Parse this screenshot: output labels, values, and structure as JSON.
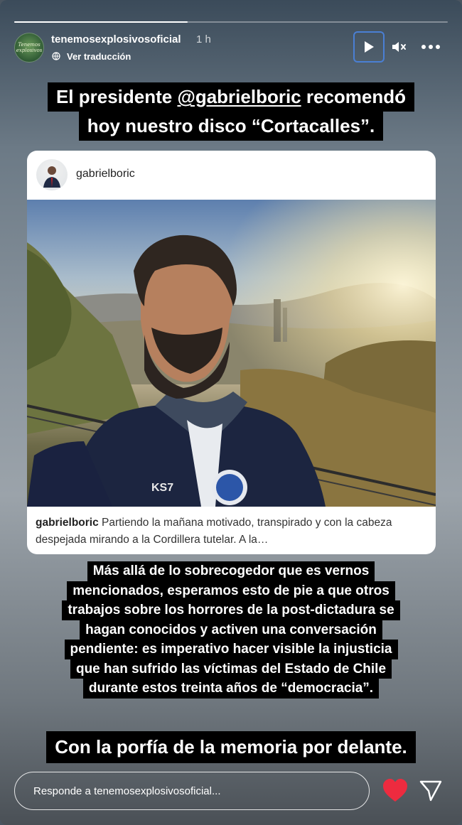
{
  "story": {
    "progress": 0.4,
    "username": "tenemosexplosivosoficial",
    "time": "1 h",
    "translate_label": "Ver traducción",
    "avatar_text": "Tenemos explosivos"
  },
  "headline": {
    "line1_prefix": "El presidente ",
    "line1_mention": "@gabrielboric",
    "line1_suffix": " recomendó",
    "line2": "hoy nuestro disco “Cortacalles”."
  },
  "card": {
    "username": "gabrielboric",
    "caption_user": "gabrielboric",
    "caption_text": "Partiendo la mañana motivado, transpirado y con la cabeza despejada mirando a la Cordillera tutelar. A la…",
    "jacket_text": "KS7"
  },
  "paragraph": [
    "Más allá de lo sobrecogedor que es vernos",
    "mencionados, esperamos esto de pie a que otros",
    "trabajos sobre los horrores de la post-dictadura se",
    "hagan conocidos y activen una conversación",
    "pendiente: es imperativo hacer visible la injusticia",
    "que han sufrido las víctimas del Estado de Chile",
    "durante estos treinta años de “democracia”."
  ],
  "tagline": "Con la porfía de la memoria por delante.",
  "reply": {
    "placeholder": "Responde a tenemosexplosivosoficial..."
  },
  "colors": {
    "heart": "#ed2b3f",
    "play_outline": "#4a7fd4"
  },
  "icons": [
    "translate-icon",
    "play-icon",
    "mute-icon",
    "more-icon",
    "heart-icon",
    "send-icon"
  ]
}
